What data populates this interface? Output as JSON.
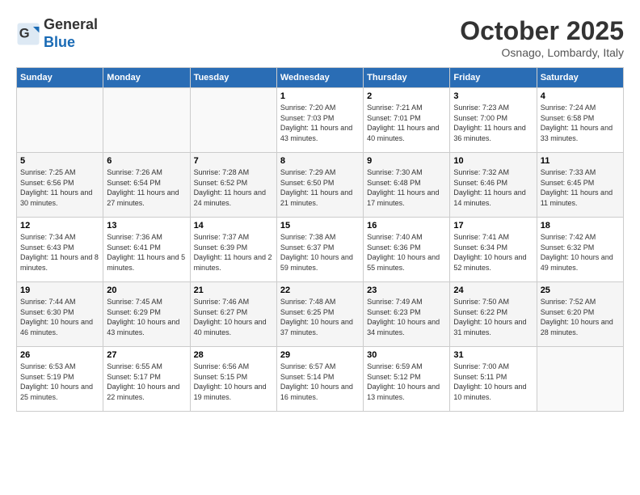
{
  "header": {
    "logo_general": "General",
    "logo_blue": "Blue",
    "month": "October 2025",
    "location": "Osnago, Lombardy, Italy"
  },
  "days_of_week": [
    "Sunday",
    "Monday",
    "Tuesday",
    "Wednesday",
    "Thursday",
    "Friday",
    "Saturday"
  ],
  "weeks": [
    [
      {
        "day": "",
        "info": ""
      },
      {
        "day": "",
        "info": ""
      },
      {
        "day": "",
        "info": ""
      },
      {
        "day": "1",
        "info": "Sunrise: 7:20 AM\nSunset: 7:03 PM\nDaylight: 11 hours and 43 minutes."
      },
      {
        "day": "2",
        "info": "Sunrise: 7:21 AM\nSunset: 7:01 PM\nDaylight: 11 hours and 40 minutes."
      },
      {
        "day": "3",
        "info": "Sunrise: 7:23 AM\nSunset: 7:00 PM\nDaylight: 11 hours and 36 minutes."
      },
      {
        "day": "4",
        "info": "Sunrise: 7:24 AM\nSunset: 6:58 PM\nDaylight: 11 hours and 33 minutes."
      }
    ],
    [
      {
        "day": "5",
        "info": "Sunrise: 7:25 AM\nSunset: 6:56 PM\nDaylight: 11 hours and 30 minutes."
      },
      {
        "day": "6",
        "info": "Sunrise: 7:26 AM\nSunset: 6:54 PM\nDaylight: 11 hours and 27 minutes."
      },
      {
        "day": "7",
        "info": "Sunrise: 7:28 AM\nSunset: 6:52 PM\nDaylight: 11 hours and 24 minutes."
      },
      {
        "day": "8",
        "info": "Sunrise: 7:29 AM\nSunset: 6:50 PM\nDaylight: 11 hours and 21 minutes."
      },
      {
        "day": "9",
        "info": "Sunrise: 7:30 AM\nSunset: 6:48 PM\nDaylight: 11 hours and 17 minutes."
      },
      {
        "day": "10",
        "info": "Sunrise: 7:32 AM\nSunset: 6:46 PM\nDaylight: 11 hours and 14 minutes."
      },
      {
        "day": "11",
        "info": "Sunrise: 7:33 AM\nSunset: 6:45 PM\nDaylight: 11 hours and 11 minutes."
      }
    ],
    [
      {
        "day": "12",
        "info": "Sunrise: 7:34 AM\nSunset: 6:43 PM\nDaylight: 11 hours and 8 minutes."
      },
      {
        "day": "13",
        "info": "Sunrise: 7:36 AM\nSunset: 6:41 PM\nDaylight: 11 hours and 5 minutes."
      },
      {
        "day": "14",
        "info": "Sunrise: 7:37 AM\nSunset: 6:39 PM\nDaylight: 11 hours and 2 minutes."
      },
      {
        "day": "15",
        "info": "Sunrise: 7:38 AM\nSunset: 6:37 PM\nDaylight: 10 hours and 59 minutes."
      },
      {
        "day": "16",
        "info": "Sunrise: 7:40 AM\nSunset: 6:36 PM\nDaylight: 10 hours and 55 minutes."
      },
      {
        "day": "17",
        "info": "Sunrise: 7:41 AM\nSunset: 6:34 PM\nDaylight: 10 hours and 52 minutes."
      },
      {
        "day": "18",
        "info": "Sunrise: 7:42 AM\nSunset: 6:32 PM\nDaylight: 10 hours and 49 minutes."
      }
    ],
    [
      {
        "day": "19",
        "info": "Sunrise: 7:44 AM\nSunset: 6:30 PM\nDaylight: 10 hours and 46 minutes."
      },
      {
        "day": "20",
        "info": "Sunrise: 7:45 AM\nSunset: 6:29 PM\nDaylight: 10 hours and 43 minutes."
      },
      {
        "day": "21",
        "info": "Sunrise: 7:46 AM\nSunset: 6:27 PM\nDaylight: 10 hours and 40 minutes."
      },
      {
        "day": "22",
        "info": "Sunrise: 7:48 AM\nSunset: 6:25 PM\nDaylight: 10 hours and 37 minutes."
      },
      {
        "day": "23",
        "info": "Sunrise: 7:49 AM\nSunset: 6:23 PM\nDaylight: 10 hours and 34 minutes."
      },
      {
        "day": "24",
        "info": "Sunrise: 7:50 AM\nSunset: 6:22 PM\nDaylight: 10 hours and 31 minutes."
      },
      {
        "day": "25",
        "info": "Sunrise: 7:52 AM\nSunset: 6:20 PM\nDaylight: 10 hours and 28 minutes."
      }
    ],
    [
      {
        "day": "26",
        "info": "Sunrise: 6:53 AM\nSunset: 5:19 PM\nDaylight: 10 hours and 25 minutes."
      },
      {
        "day": "27",
        "info": "Sunrise: 6:55 AM\nSunset: 5:17 PM\nDaylight: 10 hours and 22 minutes."
      },
      {
        "day": "28",
        "info": "Sunrise: 6:56 AM\nSunset: 5:15 PM\nDaylight: 10 hours and 19 minutes."
      },
      {
        "day": "29",
        "info": "Sunrise: 6:57 AM\nSunset: 5:14 PM\nDaylight: 10 hours and 16 minutes."
      },
      {
        "day": "30",
        "info": "Sunrise: 6:59 AM\nSunset: 5:12 PM\nDaylight: 10 hours and 13 minutes."
      },
      {
        "day": "31",
        "info": "Sunrise: 7:00 AM\nSunset: 5:11 PM\nDaylight: 10 hours and 10 minutes."
      },
      {
        "day": "",
        "info": ""
      }
    ]
  ]
}
